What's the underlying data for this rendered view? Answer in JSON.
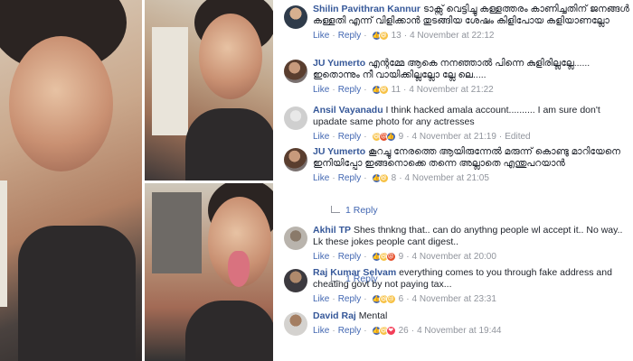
{
  "comments": [
    {
      "author": "Shilin Pavithran Kannur",
      "text": "ടാക്സ് വെട്ടിച്ചു കള്ളത്തരം കാണിച്ചതിന് ജനങ്ങൾ കള്ളതി എന്ന് വിളിക്കാൻ തുടങ്ങിയ ശേഷം കിളിപോയ കളിയാണല്ലോ",
      "like": "Like",
      "reply": "Reply",
      "reactions": [
        "like",
        "haha"
      ],
      "count": "13",
      "time": "4 November at 22:12"
    },
    {
      "author": "JU Yumerto",
      "text": "എന്റമ്മേ ആകെ നനഞ്ഞാൽ പിന്നെ കുളിരില്ലല്ലേ...... ഇതൊന്നും നീ വായിക്കില്ലല്ലോ ല്ലേ ലെ.....",
      "like": "Like",
      "reply": "Reply",
      "reactions": [
        "like",
        "haha"
      ],
      "count": "11",
      "time": "4 November at 21:22"
    },
    {
      "author": "Ansil Vayanadu",
      "text": "I think hacked amala account.......... I am sure don't upadate same photo for any actresses",
      "like": "Like",
      "reply": "Reply",
      "reactions": [
        "haha",
        "angry",
        "like"
      ],
      "count": "9",
      "time": "4 November at 21:19",
      "edited": "Edited"
    },
    {
      "author": "JU Yumerto",
      "text": "കൂറച്ചു നേരത്തെ ആയിരുന്നേൽ മരുന്ന് കൊണ്ടു മാറിയേനെ ഇനിയിപ്പോ ഇങ്ങനൊക്കെ തന്നെ അല്ലാതെ എന്തുപറയാൻ",
      "like": "Like",
      "reply": "Reply",
      "reactions": [
        "like",
        "haha"
      ],
      "count": "8",
      "time": "4 November at 21:05",
      "replies": "1 Reply"
    },
    {
      "author": "Akhil TP",
      "text": "Shes thnkng that.. can do anythng people wl accept it.. No way.. Lk these jokes people cant digest..",
      "like": "Like",
      "reply": "Reply",
      "reactions": [
        "like",
        "haha",
        "angry"
      ],
      "count": "9",
      "time": "4 November at 20:00",
      "replies": "1 Reply"
    },
    {
      "author": "Raj Kumar Selvam",
      "text": "everything comes to you through fake address and cheating govt by not paying tax...",
      "like": "Like",
      "reply": "Reply",
      "reactions": [
        "like",
        "haha",
        "sad"
      ],
      "count": "6",
      "time": "4 November at 23:31"
    },
    {
      "author": "David Raj",
      "text": "Mental",
      "like": "Like",
      "reply": "Reply",
      "reactions": [
        "like",
        "haha",
        "love"
      ],
      "count": "26",
      "time": "4 November at 19:44"
    }
  ]
}
